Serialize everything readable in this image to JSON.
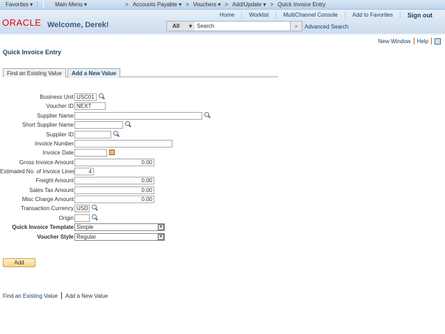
{
  "nav": {
    "favorites": "Favorites ▾",
    "main_menu": "Main Menu ▾",
    "crumbs": [
      "Accounts Payable ▾",
      "Vouchers ▾",
      "Add/Update ▾",
      "Quick Invoice Entry"
    ],
    "sep": ">"
  },
  "header": {
    "logo": "ORACLE",
    "welcome": "Welcome, Derek!",
    "links": [
      "Home",
      "Worklist",
      "MultiChannel Console",
      "Add to Favorites",
      "Sign out"
    ],
    "search_scope": "All",
    "search_placeholder": "Search",
    "go": "»",
    "advanced_search": "Advanced Search"
  },
  "page_links": {
    "new_window": "New Window",
    "help": "Help"
  },
  "page_title": "Quick Invoice Entry",
  "tabs": [
    {
      "label": "Find an Existing Value",
      "active": false
    },
    {
      "label": "Add a New Value",
      "active": true
    }
  ],
  "form": {
    "business_unit": {
      "label": "Business Unit",
      "value": "USC01"
    },
    "voucher_id": {
      "label": "Voucher ID",
      "value": "NEXT"
    },
    "supplier_name": {
      "label": "Supplier Name",
      "value": ""
    },
    "short_supplier_name": {
      "label": "Short Supplier Name",
      "value": ""
    },
    "supplier_id": {
      "label": "Supplier ID",
      "value": ""
    },
    "invoice_number": {
      "label": "Invoice Number",
      "value": ""
    },
    "invoice_date": {
      "label": "Invoice Date",
      "value": ""
    },
    "gross_invoice_amount": {
      "label": "Gross Invoice Amount",
      "value": "0.00"
    },
    "est_invoice_lines": {
      "label": "Estimated No. of Invoice Lines",
      "value": "4"
    },
    "freight_amount": {
      "label": "Freight Amount",
      "value": "0.00"
    },
    "sales_tax_amount": {
      "label": "Sales Tax Amount",
      "value": "0.00"
    },
    "misc_charge_amount": {
      "label": "Misc Charge Amount",
      "value": "0.00"
    },
    "transaction_currency": {
      "label": "Transaction Currency",
      "value": "USD"
    },
    "origin": {
      "label": "Origin",
      "value": ""
    },
    "quick_invoice_template": {
      "label": "Quick Invoice Template",
      "value": "Simple"
    },
    "voucher_style": {
      "label": "Voucher Style",
      "value": "Regular"
    }
  },
  "add_button": "Add",
  "bottom": {
    "find_pre": "Find an ",
    "find_link": "Existing",
    "find_post": " Value",
    "add_new": "Add a New Value"
  }
}
